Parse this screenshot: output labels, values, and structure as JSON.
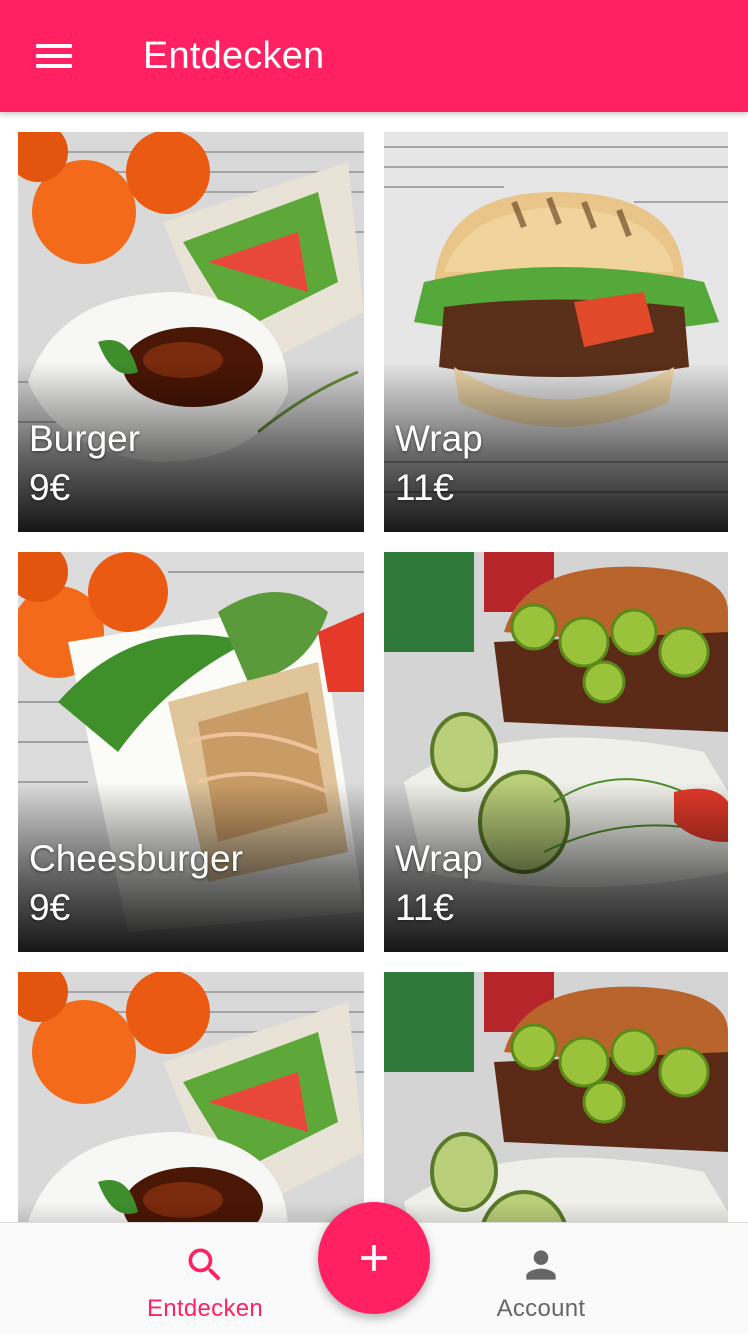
{
  "theme": {
    "primary": "#ff2161",
    "text_on_primary": "#ffffff",
    "inactive": "#666666"
  },
  "appbar": {
    "title": "Entdecken",
    "menu_icon": "menu-icon"
  },
  "products": [
    {
      "name": "Burger",
      "price": "9€",
      "image": "wrap-with-dip-photo"
    },
    {
      "name": "Wrap",
      "price": "11€",
      "image": "burger-photo"
    },
    {
      "name": "Cheesburger",
      "price": "9€",
      "image": "salad-bowl-photo"
    },
    {
      "name": "Wrap",
      "price": "11€",
      "image": "jalapeno-burger-photo"
    },
    {
      "name": "",
      "price": "",
      "image": "wrap-with-dip-photo"
    },
    {
      "name": "",
      "price": "",
      "image": "jalapeno-burger-photo"
    }
  ],
  "fab": {
    "icon": "add-icon"
  },
  "bottom_nav": {
    "items": [
      {
        "label": "Entdecken",
        "icon": "search-icon",
        "active": true
      },
      {
        "label": "Account",
        "icon": "person-icon",
        "active": false
      }
    ]
  }
}
